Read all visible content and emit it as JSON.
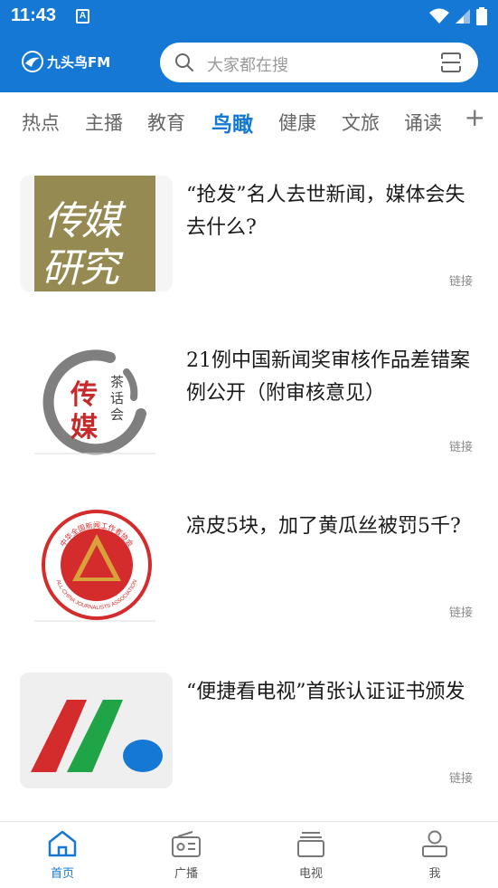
{
  "status_bar": {
    "time": "11:43",
    "notification_letter": "A"
  },
  "app": {
    "logo_text": "九头鸟FM"
  },
  "search": {
    "placeholder": "大家都在搜"
  },
  "tabs": [
    {
      "label": "热点"
    },
    {
      "label": "主播"
    },
    {
      "label": "教育"
    },
    {
      "label": "鸟瞰",
      "active": true
    },
    {
      "label": "健康"
    },
    {
      "label": "文旅"
    },
    {
      "label": "诵读"
    }
  ],
  "articles": [
    {
      "title": "“抢发”名人去世新闻，媒体会失去什么?",
      "tag": "链接",
      "thumb_text": [
        "传媒",
        "研究"
      ]
    },
    {
      "title": "21例中国新闻奖审核作品差错案例公开（附审核意见）",
      "tag": "链接",
      "thumb_text": [
        "传",
        "媒",
        "茶话会"
      ]
    },
    {
      "title": "凉皮5块，加了黄瓜丝被罚5千?",
      "tag": "链接",
      "thumb_text": [
        "中华全国新闻工作者协会",
        "ALL-CHINA JOURNALISTS ASSOCIATION"
      ]
    },
    {
      "title": "“便捷看电视”首张认证证书颁发",
      "tag": "链接"
    }
  ],
  "bottom_nav": [
    {
      "label": "首页",
      "icon": "home-icon",
      "active": true
    },
    {
      "label": "广播",
      "icon": "radio-icon"
    },
    {
      "label": "电视",
      "icon": "tv-icon"
    },
    {
      "label": "我",
      "icon": "profile-icon"
    }
  ],
  "colors": {
    "brand_blue": "#1478d4",
    "olive": "#968a53",
    "red": "#d42c2c",
    "green": "#1fa447"
  }
}
